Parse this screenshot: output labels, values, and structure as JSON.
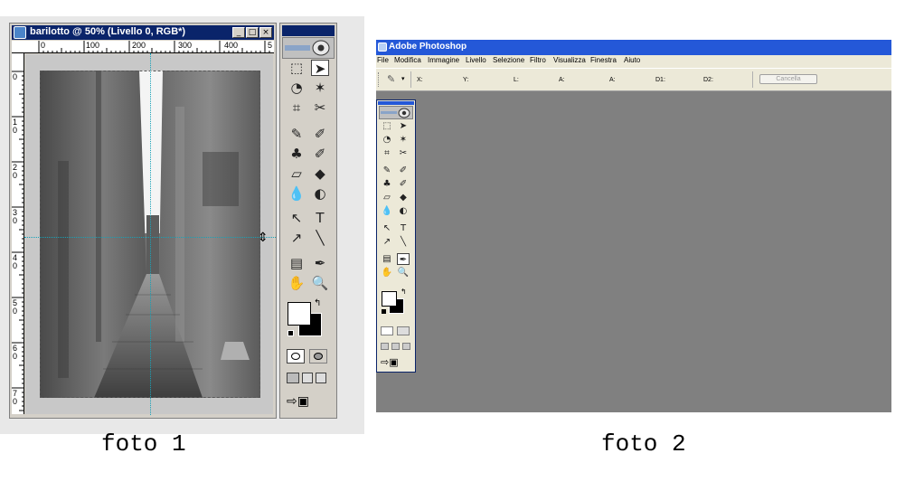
{
  "foto1": {
    "caption": "foto 1",
    "document_title": "barilotto @ 50% (Livello 0, RGB*)",
    "window_buttons": [
      "_",
      "□",
      "×"
    ],
    "ruler_top_labels": [
      "0",
      "100",
      "200",
      "300",
      "400",
      "5"
    ],
    "ruler_left_labels": [
      "0",
      "1 0",
      "2 0",
      "3 0",
      "4 0",
      "5 0",
      "6 0",
      "7 0"
    ],
    "toolbox_tools": [
      "marquee-icon",
      "move-icon",
      "lasso-icon",
      "magic-wand-icon",
      "crop-icon",
      "slice-icon",
      "healing-brush-icon",
      "brush-icon",
      "clone-stamp-icon",
      "history-brush-icon",
      "eraser-icon",
      "paint-bucket-icon",
      "blur-icon",
      "dodge-icon",
      "path-selection-icon",
      "type-icon",
      "pen-icon",
      "line-icon",
      "notes-icon",
      "eyedropper-icon",
      "hand-icon",
      "zoom-icon"
    ],
    "toolbox_symbols": [
      "⬚",
      "➤",
      "◔",
      "✶",
      "⌗",
      "✂",
      "✎",
      "✐",
      "♣",
      "✐",
      "▱",
      "◆",
      "💧",
      "◐",
      "↖",
      "T",
      "↗",
      "╲",
      "▤",
      "✒",
      "✋",
      "🔍"
    ],
    "colors": {
      "foreground": "#ffffff",
      "background": "#000000",
      "guide": "#17a2b8",
      "title_bar": "#0a246a"
    }
  },
  "foto2": {
    "caption": "foto 2",
    "app_title": "Adobe Photoshop",
    "menu": [
      "File",
      "Modifica",
      "Immagine",
      "Livello",
      "Selezione",
      "Filtro",
      "Visualizza",
      "Finestra",
      "Aiuto"
    ],
    "options": {
      "x": "X:",
      "y": "Y:",
      "l": "L:",
      "a1": "A:",
      "a2": "A:",
      "d1": "D1:",
      "d2": "D2:",
      "cancel": "Cancella"
    },
    "colors": {
      "title_bar": "#2458d8",
      "workspace": "#808080",
      "menu_bg": "#ece9d8"
    }
  }
}
